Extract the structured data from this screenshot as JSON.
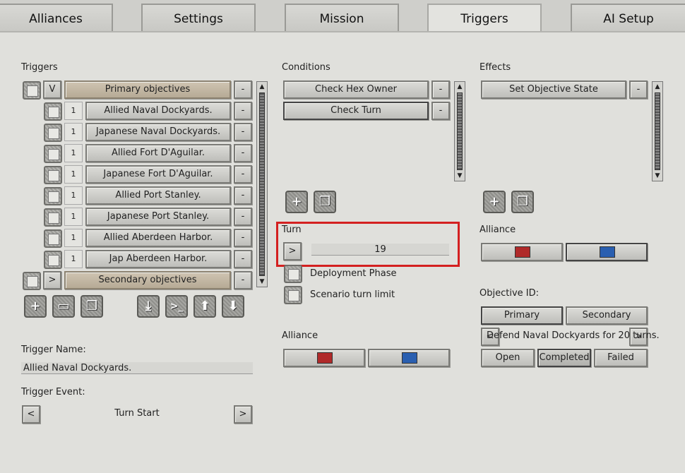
{
  "tabs": [
    "Alliances",
    "Settings",
    "Mission",
    "Triggers",
    "AI Setup"
  ],
  "triggers": {
    "label": "Triggers",
    "group_primary": {
      "toggle": "V",
      "label": "Primary objectives",
      "menu": "-"
    },
    "items": [
      {
        "count": "1",
        "label": "Allied Naval Dockyards.",
        "menu": "-"
      },
      {
        "count": "1",
        "label": "Japanese Naval Dockyards.",
        "menu": "-"
      },
      {
        "count": "1",
        "label": "Allied Fort D'Aguilar.",
        "menu": "-"
      },
      {
        "count": "1",
        "label": "Japanese Fort D'Aguilar.",
        "menu": "-"
      },
      {
        "count": "1",
        "label": "Allied Port Stanley.",
        "menu": "-"
      },
      {
        "count": "1",
        "label": "Japanese Port Stanley.",
        "menu": "-"
      },
      {
        "count": "1",
        "label": "Allied Aberdeen Harbor.",
        "menu": "-"
      },
      {
        "count": "1",
        "label": "Jap Aberdeen Harbor.",
        "menu": "-"
      }
    ],
    "group_secondary": {
      "toggle": ">",
      "label": "Secondary objectives",
      "menu": "-"
    },
    "toolbar_icons": [
      "add-icon",
      "folder-icon",
      "copy-icon",
      "import-icon",
      "console-icon",
      "move-up-icon",
      "move-down-icon"
    ]
  },
  "trigger_name": {
    "label": "Trigger Name:",
    "value": "Allied Naval Dockyards."
  },
  "trigger_event": {
    "label": "Trigger Event:",
    "prev": "<",
    "value": "Turn Start",
    "next": ">"
  },
  "conditions": {
    "label": "Conditions",
    "items": [
      {
        "label": "Check Hex Owner",
        "menu": "-"
      },
      {
        "label": "Check Turn",
        "menu": "-"
      }
    ]
  },
  "turn": {
    "label": "Turn",
    "toggle": ">",
    "value": "19",
    "deployment_phase": "Deployment Phase",
    "scenario_turn_limit": "Scenario turn limit"
  },
  "condition_alliance": {
    "label": "Alliance"
  },
  "effects": {
    "label": "Effects",
    "items": [
      {
        "label": "Set Objective State",
        "menu": "-"
      }
    ]
  },
  "effect_alliance": {
    "label": "Alliance"
  },
  "objective": {
    "label": "Objective ID:",
    "type_primary": "Primary",
    "type_secondary": "Secondary",
    "prev": "<",
    "name": "Defend Naval Dockyards for 20 turns.",
    "next": ">",
    "state_open": "Open",
    "state_completed": "Completed",
    "state_failed": "Failed"
  },
  "colors": {
    "allied": "#b02a2a",
    "axis": "#2a5fb0",
    "highlight": "#d42020"
  }
}
